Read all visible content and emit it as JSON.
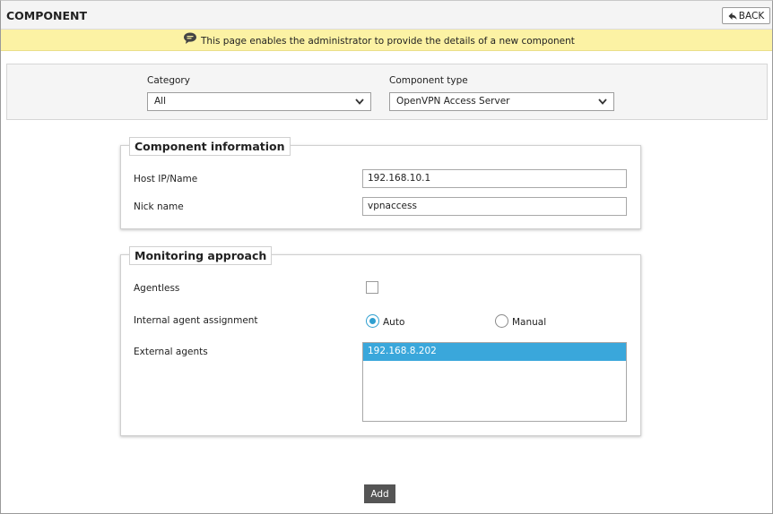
{
  "header": {
    "title": "COMPONENT",
    "back_label": "BACK"
  },
  "info": {
    "text": "This page enables the administrator to provide the details of a new component",
    "icon": "speech-bubble-icon"
  },
  "filters": {
    "category_label": "Category",
    "category_value": "All",
    "component_type_label": "Component type",
    "component_type_value": "OpenVPN Access Server"
  },
  "component_info": {
    "legend": "Component information",
    "host_label": "Host IP/Name",
    "host_value": "192.168.10.1",
    "nick_label": "Nick name",
    "nick_value": "vpnaccess"
  },
  "monitoring": {
    "legend": "Monitoring approach",
    "agentless_label": "Agentless",
    "agentless_checked": false,
    "assignment_label": "Internal agent assignment",
    "auto_label": "Auto",
    "manual_label": "Manual",
    "selected_assignment": "Auto",
    "external_label": "External agents",
    "external_agents": [
      "192.168.8.202"
    ],
    "selected_agent": "192.168.8.202"
  },
  "actions": {
    "add_label": "Add"
  },
  "colors": {
    "info_bar": "#fcf2a4",
    "selection": "#3aa7db",
    "radio_accent": "#2f9fd0",
    "add_button": "#555555"
  }
}
